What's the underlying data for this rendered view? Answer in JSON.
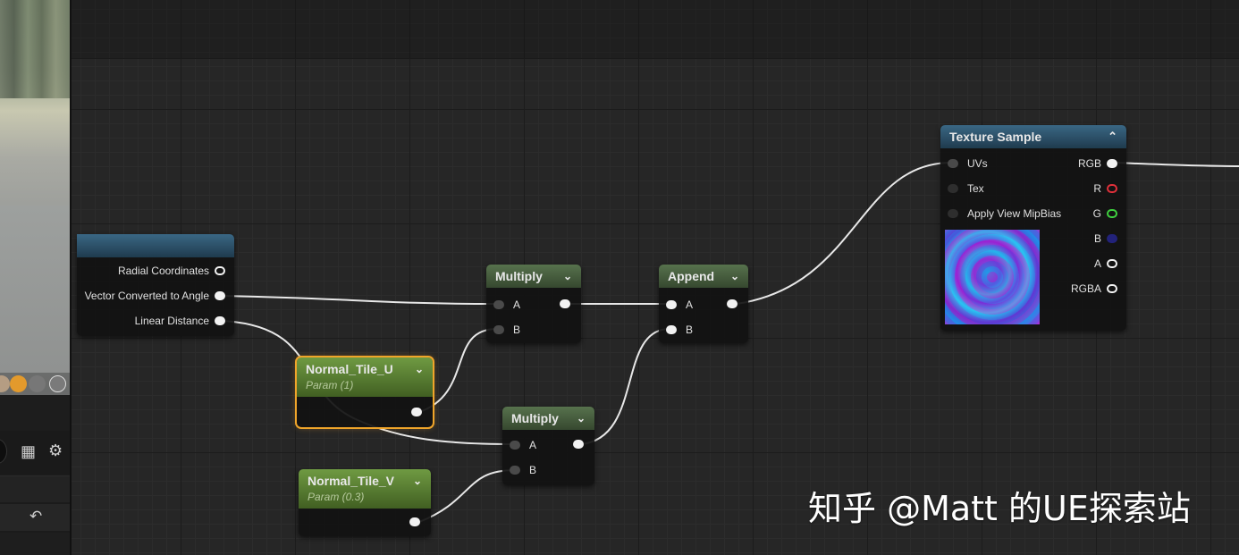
{
  "texture_sample": {
    "title": "Texture Sample",
    "inputs": [
      "UVs",
      "Tex",
      "Apply View MipBias"
    ],
    "outputs": [
      "RGB",
      "R",
      "G",
      "B",
      "A",
      "RGBA"
    ],
    "output_colors": {
      "R": "#e0303a",
      "G": "#3fd03f",
      "B": "#2d2db8"
    }
  },
  "coord_node": {
    "outputs": [
      "Radial Coordinates",
      "Vector Converted to Angle",
      "Linear Distance"
    ]
  },
  "multiply_1": {
    "title": "Multiply",
    "inputs": [
      "A",
      "B"
    ]
  },
  "multiply_2": {
    "title": "Multiply",
    "inputs": [
      "A",
      "B"
    ]
  },
  "append": {
    "title": "Append",
    "inputs": [
      "A",
      "B"
    ]
  },
  "normal_tile_u": {
    "title": "Normal_Tile_U",
    "subtitle": "Param (1)"
  },
  "normal_tile_v": {
    "title": "Normal_Tile_V",
    "subtitle": "Param (0.3)"
  },
  "watermark": "知乎 @Matt 的UE探索站",
  "icons": [
    "table-icon",
    "gear-icon",
    "undo-icon",
    "chevron-down-icon",
    "chevron-up-icon"
  ],
  "colors": {
    "selection": "#f0a52a",
    "param_header": "#5a8436",
    "texture_header": "#2f566f"
  }
}
